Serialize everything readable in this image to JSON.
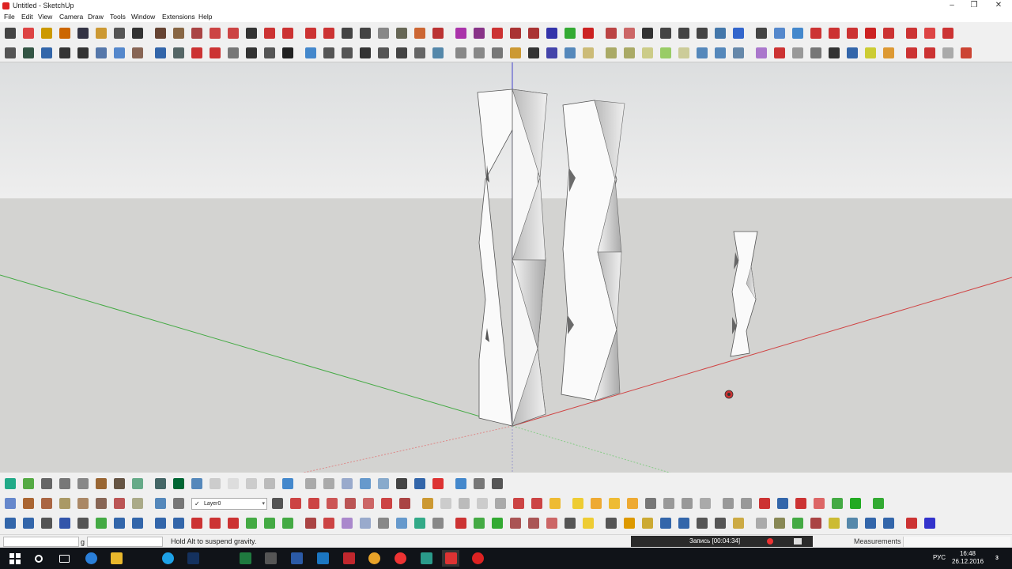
{
  "window": {
    "title": "Untitled - SketchUp",
    "minimize": "–",
    "maximize": "❐",
    "close": "✕"
  },
  "menu": [
    "File",
    "Edit",
    "View",
    "Camera",
    "Draw",
    "Tools",
    "Window",
    "Extensions",
    "Help"
  ],
  "toolbar_colors": {
    "top": [
      "#444",
      "#d44",
      "#c90",
      "#c60",
      "#334",
      "#c93",
      "#555",
      "#333",
      "#643",
      "#864",
      "#a44",
      "#c44",
      "#c44",
      "#333",
      "#c33",
      "#c33",
      "#c33",
      "#c33",
      "#444",
      "#444",
      "#888",
      "#665",
      "#c63",
      "#b33",
      "#a3a",
      "#838",
      "#c33",
      "#a33",
      "#a33",
      "#33a",
      "#3a3",
      "#c22",
      "#b44",
      "#c66",
      "#333",
      "#444",
      "#444",
      "#444",
      "#47a",
      "#36c",
      "#444",
      "#58c",
      "#48c",
      "#c33",
      "#c33",
      "#c33",
      "#c22",
      "#c33",
      "#c33",
      "#d44",
      "#c33"
    ],
    "second": [
      "#555",
      "#354",
      "#36a",
      "#333",
      "#333",
      "#57a",
      "#58c",
      "#865",
      "#36a",
      "#566",
      "#c33",
      "#c33",
      "#777",
      "#333",
      "#555",
      "#222",
      "#48c",
      "#555",
      "#555",
      "#333",
      "#555",
      "#444",
      "#666",
      "#58a",
      "#888",
      "#888",
      "#777",
      "#c93",
      "#333",
      "#44a",
      "#58b",
      "#cb7",
      "#aa6",
      "#aa6",
      "#cc8",
      "#9c6",
      "#cc9",
      "#58b",
      "#58b",
      "#68a",
      "#a7c",
      "#c33",
      "#999",
      "#777",
      "#333",
      "#36a",
      "#cc3",
      "#d93",
      "#c33",
      "#c33",
      "#aaa",
      "#c43"
    ],
    "bottom1": [
      "#2a8",
      "#5a4",
      "#666",
      "#777",
      "#888",
      "#963",
      "#654",
      "#6a8",
      "#466",
      "#063",
      "#58b",
      "#ccc",
      "#ddd",
      "#ccc",
      "#bbb",
      "#48c",
      "#aaa",
      "#aaa",
      "#9ac",
      "#69c",
      "#8ac",
      "#444",
      "#36a",
      "#d33",
      "#48c",
      "#777",
      "#555"
    ],
    "bottom2": [
      "#68c",
      "#a63",
      "#a64",
      "#a96",
      "#a86",
      "#865",
      "#b55",
      "#aa8",
      "#58b",
      "#777",
      "#555",
      "#c44",
      "#c44",
      "#c55",
      "#b55",
      "#c66",
      "#c44",
      "#a44",
      "#c93",
      "#ccc",
      "#bbb",
      "#ccc",
      "#aaa",
      "#c44",
      "#c44",
      "#eb3",
      "#ec3",
      "#ea3",
      "#eb3",
      "#ea3",
      "#777",
      "#999",
      "#999",
      "#aaa",
      "#999",
      "#999",
      "#c33",
      "#36a",
      "#c33",
      "#d66",
      "#4a4",
      "#2a2",
      "#3a3"
    ],
    "bottom3": [
      "#36a",
      "#36a",
      "#555",
      "#35a",
      "#555",
      "#4a4",
      "#36a",
      "#36a",
      "#36a",
      "#36a",
      "#c33",
      "#c33",
      "#c33",
      "#4a4",
      "#4a4",
      "#4a4",
      "#a44",
      "#c44",
      "#a8c",
      "#9ac",
      "#888",
      "#69c",
      "#3a8",
      "#888",
      "#c33",
      "#4a4",
      "#3a3",
      "#a55",
      "#a55",
      "#c66",
      "#555",
      "#ec3",
      "#555",
      "#d90",
      "#ca3",
      "#36a",
      "#36a",
      "#555",
      "#555",
      "#ca4",
      "#aaa",
      "#885",
      "#4a4",
      "#a44",
      "#cb3",
      "#58a",
      "#36a",
      "#36a",
      "#c33",
      "#33c"
    ]
  },
  "layer": {
    "name": "Layer0",
    "check": "✓",
    "dropdown": "▾"
  },
  "status": {
    "text": "Hold  Alt  to suspend gravity.",
    "left_fragment": "g",
    "measurements_label": "Measurements"
  },
  "recorder": {
    "label": "Запись [00:04:34]"
  },
  "taskbar": {
    "lang": "РУС",
    "time": "16:48",
    "date": "26.12.2016",
    "notif": "3"
  },
  "scene": {
    "sky_color": "#e9eaea",
    "ground_color": "#d3d3d1",
    "axis_colors": {
      "red": "#cc3333",
      "green": "#33aa33",
      "blue": "#3333cc"
    }
  }
}
